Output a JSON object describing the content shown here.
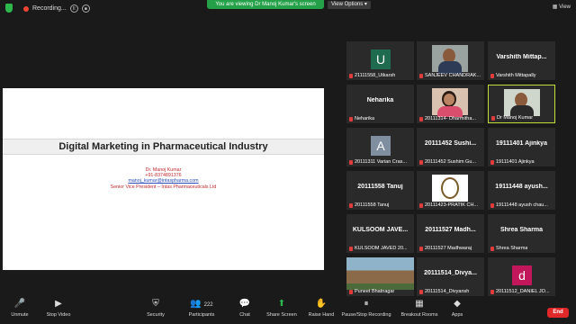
{
  "topbar": {
    "recording_label": "Recording...",
    "viewing_banner": "You are viewing Dr Manoj Kumar's screen",
    "view_options": "View Options ▾",
    "view_label": "View"
  },
  "slide": {
    "title": "Digital Marketing in Pharmaceutical Industry",
    "lines": [
      "Dr. Manoj Kumar",
      "+91-8374891376",
      "manoj_kumar@intaspharma.com",
      "Senior Vice President – Intas Pharmaceuticals Ltd"
    ]
  },
  "participants": [
    {
      "name": "21111558_Utkarsh",
      "big": "",
      "avatar": "U",
      "avatar_color": "#1f6b4f"
    },
    {
      "name": "SANJEEV CHANDRAK...",
      "big": "",
      "avatar": "",
      "photo": "man"
    },
    {
      "name": "Varshith Mittapally",
      "big": "Varshith Mittap...",
      "avatar": ""
    },
    {
      "name": "Neharika",
      "big": "Neharika",
      "avatar": ""
    },
    {
      "name": "20111314- Dharmitha...",
      "big": "",
      "avatar": "",
      "photo": "woman"
    },
    {
      "name": "Dr Manoj Kumar",
      "big": "",
      "avatar": "",
      "photo": "man2",
      "active": true
    },
    {
      "name": "20111311 Varian Cras...",
      "big": "",
      "avatar": "A",
      "avatar_color": "#7f8fa0"
    },
    {
      "name": "20111452 Sushim Gu...",
      "big": "20111452 Sushi...",
      "avatar": ""
    },
    {
      "name": "19111401 Ajinkya",
      "big": "19111401 Ajinkya",
      "avatar": ""
    },
    {
      "name": "20111558 Tanuj",
      "big": "20111558 Tanuj",
      "avatar": ""
    },
    {
      "name": "20111423-PRATIK CH...",
      "big": "",
      "avatar": "",
      "photo": "seal"
    },
    {
      "name": "19111448 ayush chau...",
      "big": "19111448 ayush...",
      "avatar": ""
    },
    {
      "name": "KULSOOM JAVED 20...",
      "big": "KULSOOM JAVE...",
      "avatar": ""
    },
    {
      "name": "20111527 Madhwaraj",
      "big": "20111527 Madh...",
      "avatar": ""
    },
    {
      "name": "Shrea Sharma",
      "big": "Shrea Sharma",
      "avatar": ""
    },
    {
      "name": "Puneet Bhatnagar",
      "big": "",
      "avatar": "",
      "photo": "building"
    },
    {
      "name": "20111514_Divyansh",
      "big": "20111514_Divya...",
      "avatar": ""
    },
    {
      "name": "20111512_DANIEL JO...",
      "big": "",
      "avatar": "d",
      "avatar_color": "#c2185b"
    }
  ],
  "toolbar": {
    "unmute": "Unmute",
    "stop_video": "Stop Video",
    "security": "Security",
    "participants": "Participants",
    "participants_count": "222",
    "chat": "Chat",
    "share_screen": "Share Screen",
    "raise_hand": "Raise Hand",
    "pause_recording": "Pause/Stop Recording",
    "breakout_rooms": "Breakout Rooms",
    "apps": "Apps",
    "end": "End"
  },
  "colors": {
    "accent_green": "#2db84d",
    "end_red": "#e02828",
    "active_speaker": "#c6dc3a"
  }
}
